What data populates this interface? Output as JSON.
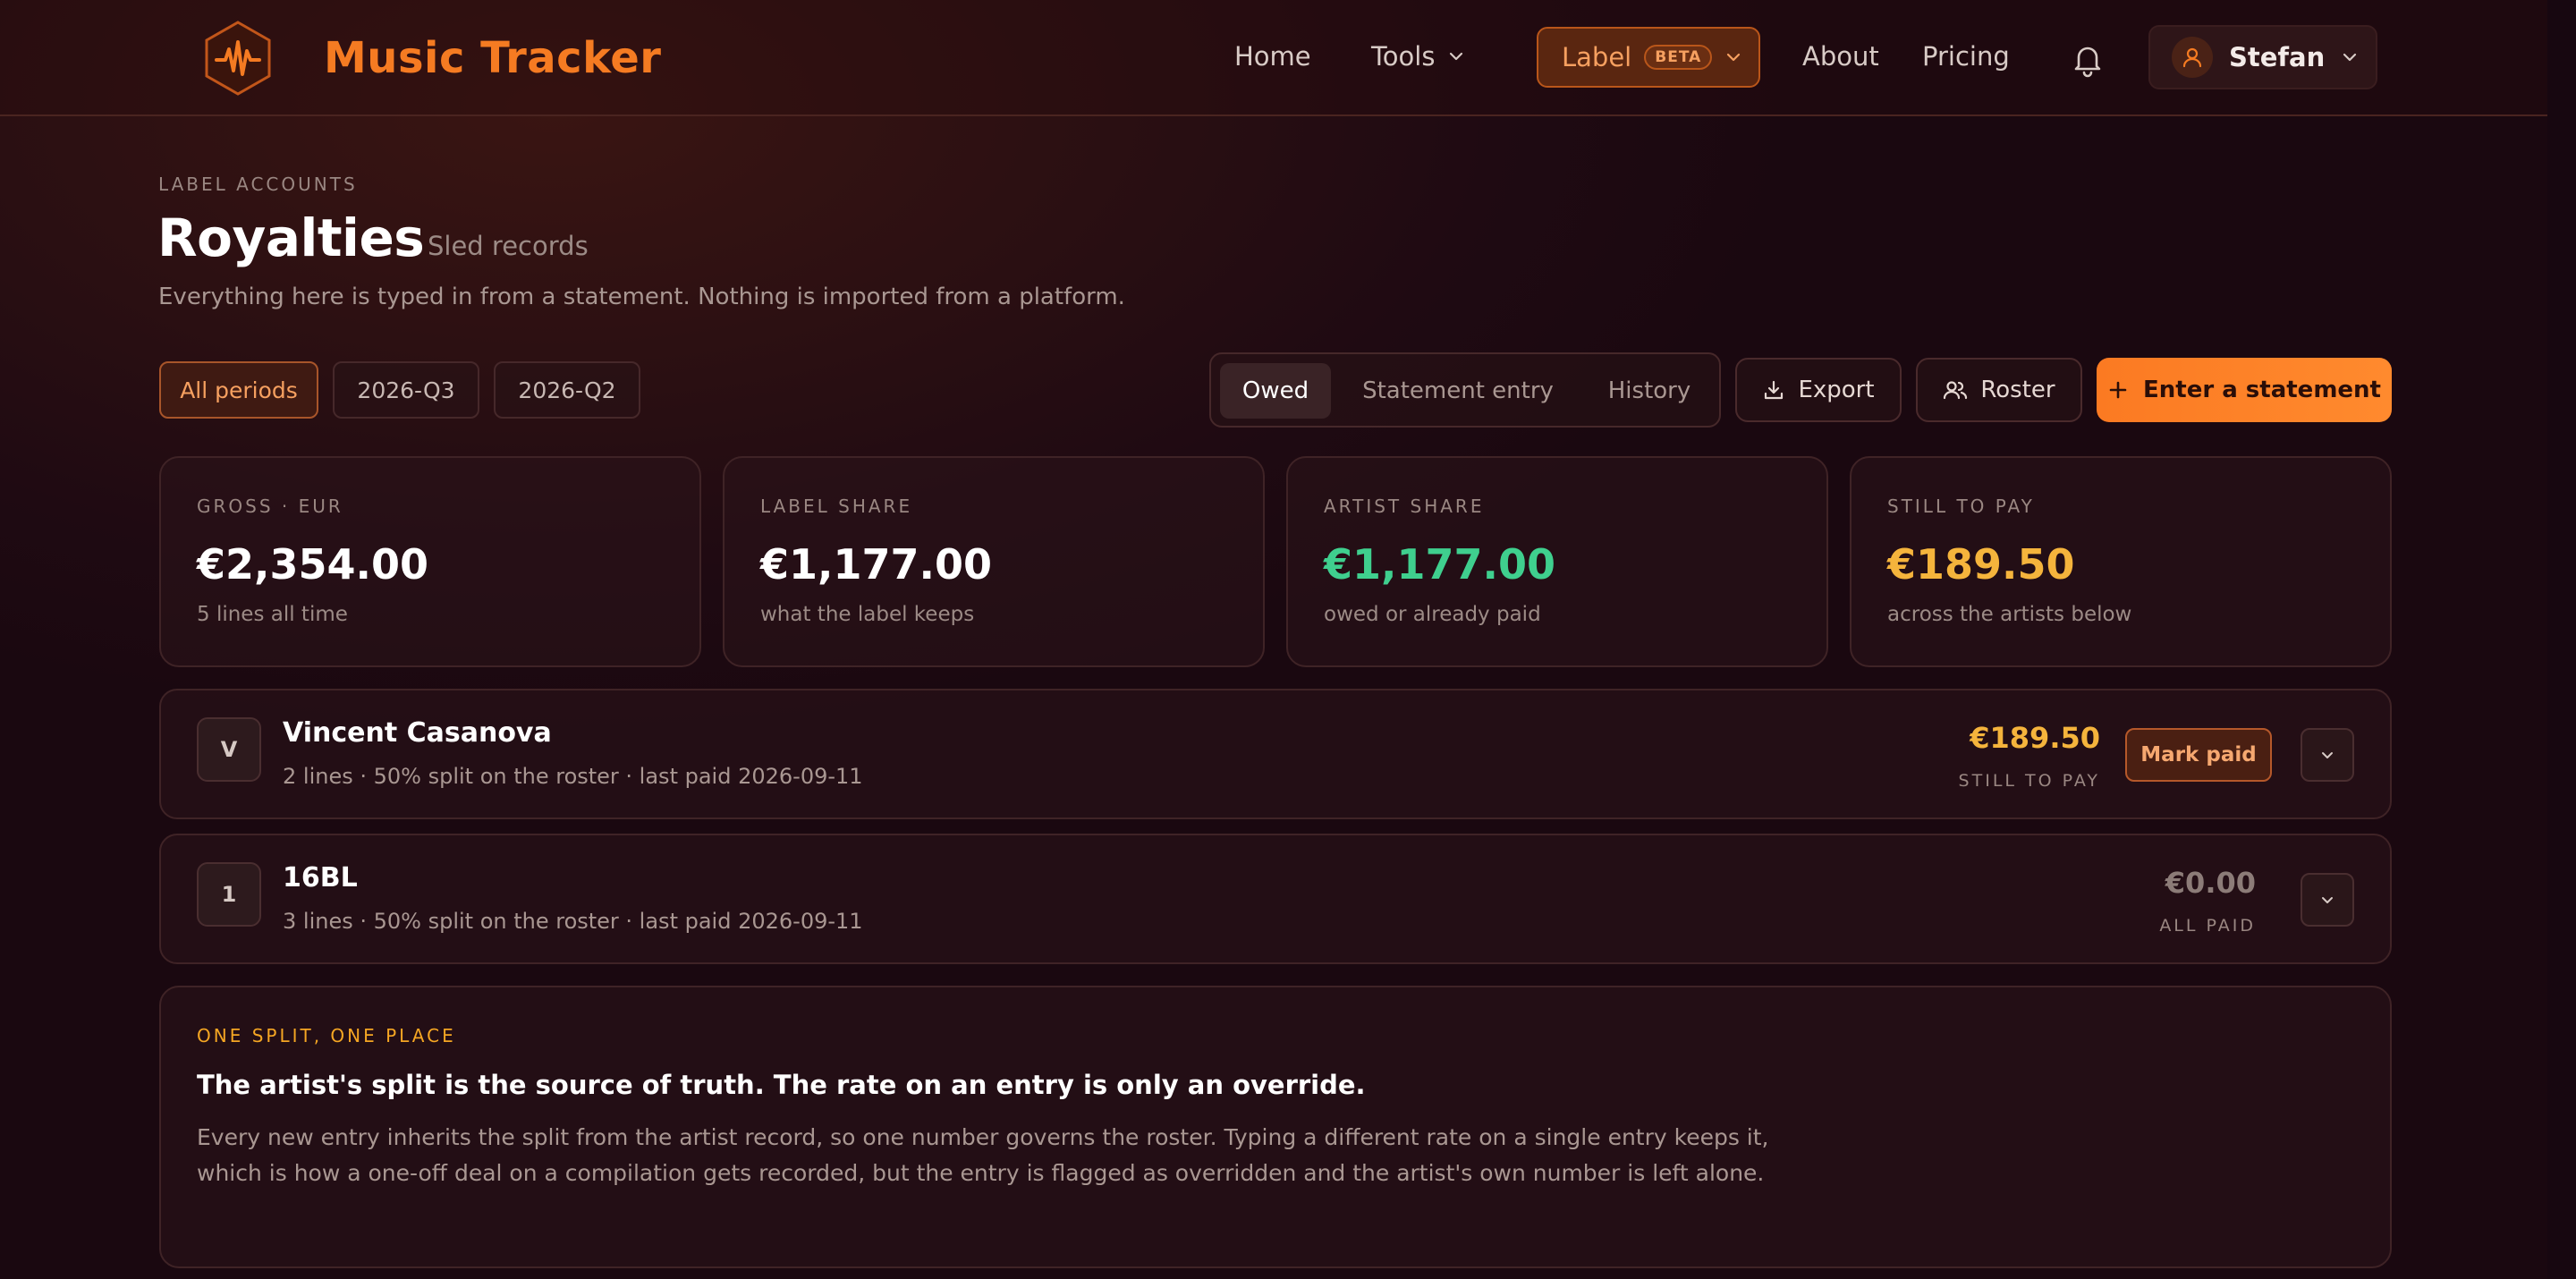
{
  "app": {
    "name": "Music Tracker"
  },
  "nav": {
    "home": "Home",
    "tools": "Tools",
    "label": "Label",
    "label_badge": "BETA",
    "about": "About",
    "pricing": "Pricing",
    "user": "Stefan"
  },
  "header": {
    "eyebrow": "LABEL ACCOUNTS",
    "title": "Royalties",
    "label_name": "Sled records",
    "description": "Everything here is typed in from a statement. Nothing is imported from a platform."
  },
  "filters": {
    "periods": [
      "All periods",
      "2026-Q3",
      "2026-Q2"
    ],
    "active_period": "All periods"
  },
  "tabs": {
    "items": [
      "Owed",
      "Statement entry",
      "History"
    ],
    "active": "Owed"
  },
  "actions": {
    "export": "Export",
    "roster": "Roster",
    "enter_statement": "Enter a statement"
  },
  "stats": [
    {
      "label": "GROSS · EUR",
      "value": "€2,354.00",
      "note": "5 lines all time",
      "color": "#ffffff"
    },
    {
      "label": "LABEL SHARE",
      "value": "€1,177.00",
      "note": "what the label keeps",
      "color": "#ffffff"
    },
    {
      "label": "ARTIST SHARE",
      "value": "€1,177.00",
      "note": "owed or already paid",
      "color": "#3fcf8e"
    },
    {
      "label": "STILL TO PAY",
      "value": "€189.50",
      "note": "across the artists below",
      "color": "#f5b43c"
    }
  ],
  "artists": [
    {
      "initial": "V",
      "name": "Vincent Casanova",
      "meta": "2 lines · 50% split on the roster · last paid 2026-09-11",
      "amount": "€189.50",
      "status": "STILL TO PAY",
      "amount_color": "#f5b43c",
      "action": "Mark paid"
    },
    {
      "initial": "1",
      "name": "16BL",
      "meta": "3 lines · 50% split on the roster · last paid 2026-09-11",
      "amount": "€0.00",
      "status": "ALL PAID",
      "amount_color": "#8c7c78"
    }
  ],
  "info": {
    "eyebrow": "ONE SPLIT, ONE PLACE",
    "title": "The artist's split is the source of truth. The rate on an entry is only an override.",
    "body": "Every new entry inherits the split from the artist record, so one number governs the roster. Typing a different rate on a single entry keeps it, which is how a one-off deal on a compilation gets recorded, but the entry is flagged as overridden and the artist's own number is left alone."
  },
  "colors": {
    "accent": "#f57b22",
    "positive": "#3fcf8e",
    "pending": "#f5b43c"
  }
}
